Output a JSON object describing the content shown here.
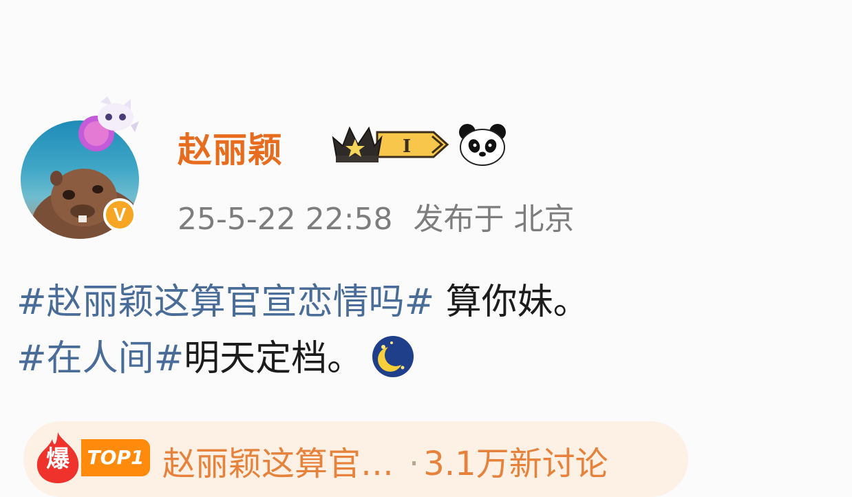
{
  "user": {
    "name": "赵丽颖",
    "verified_badge": "V",
    "avatar": "capybara-avatar",
    "level_badge": "I"
  },
  "post": {
    "timestamp": "25-5-22 22:58",
    "location": "发布于 北京",
    "line1_topic": "#赵丽颖这算官宣恋情吗#",
    "line1_text": " 算你妹。",
    "line2_topic": "#在人间#",
    "line2_text": "明天定档。"
  },
  "hot": {
    "icon_label": "爆",
    "rank": "TOP1",
    "title": "赵丽颖这算官…",
    "separator": "·",
    "discussion": "3.1万新讨论"
  },
  "colors": {
    "username": "#e86c1e",
    "topic_link": "#4a6c98",
    "hot_bg": "#fdf1e6",
    "hot_badge": "#ff8a0c",
    "bao_icon": "#f0322d"
  }
}
